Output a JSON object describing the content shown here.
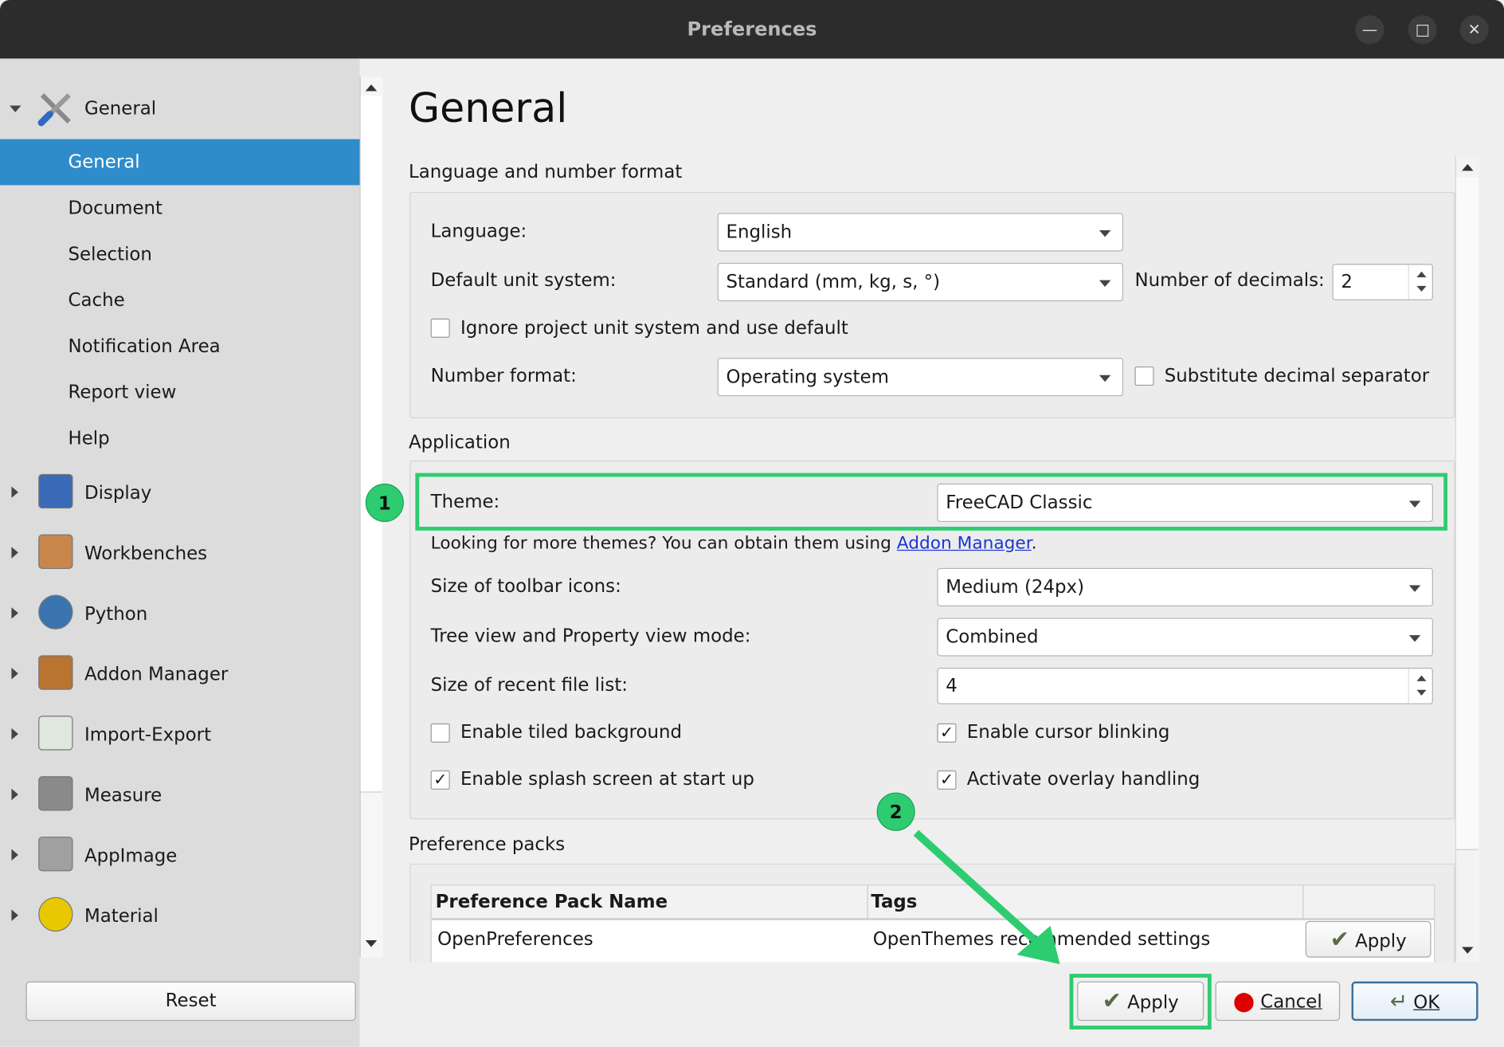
{
  "window": {
    "title": "Preferences",
    "controls": [
      "minimize",
      "maximize",
      "close"
    ]
  },
  "sidebar": {
    "group_general": {
      "label": "General",
      "expanded": true,
      "children": [
        "General",
        "Document",
        "Selection",
        "Cache",
        "Notification Area",
        "Report view",
        "Help"
      ],
      "selected": "General"
    },
    "groups": [
      {
        "label": "Display",
        "icon": "monitor-icon"
      },
      {
        "label": "Workbenches",
        "icon": "workbench-box-icon"
      },
      {
        "label": "Python",
        "icon": "python-icon"
      },
      {
        "label": "Addon Manager",
        "icon": "addon-box-icon"
      },
      {
        "label": "Import-Export",
        "icon": "import-export-icon"
      },
      {
        "label": "Measure",
        "icon": "caliper-icon"
      },
      {
        "label": "AppImage",
        "icon": "appimage-icon"
      },
      {
        "label": "Material",
        "icon": "material-sphere-icon"
      }
    ],
    "reset_label": "Reset"
  },
  "page": {
    "heading": "General"
  },
  "lang_group": {
    "title": "Language and number format",
    "language_label": "Language:",
    "language_value": "English",
    "unit_label": "Default unit system:",
    "unit_value": "Standard (mm, kg, s, °)",
    "decimals_label": "Number of decimals:",
    "decimals_value": "2",
    "ignore_label": "Ignore project unit system and use default",
    "ignore_checked": false,
    "numformat_label": "Number format:",
    "numformat_value": "Operating system",
    "substitute_label": "Substitute decimal separator",
    "substitute_checked": false
  },
  "app_group": {
    "title": "Application",
    "theme_label": "Theme:",
    "theme_value": "FreeCAD Classic",
    "themes_hint": "Looking for more themes? You can obtain them using ",
    "themes_link": "Addon Manager",
    "themes_hint_end": ".",
    "toolbar_label": "Size of toolbar icons:",
    "toolbar_value": "Medium (24px)",
    "treeview_label": "Tree view and Property view mode:",
    "treeview_value": "Combined",
    "recent_label": "Size of recent file list:",
    "recent_value": "4",
    "tiled_label": "Enable tiled background",
    "tiled_checked": false,
    "blink_label": "Enable cursor blinking",
    "blink_checked": true,
    "splash_label": "Enable splash screen at start up",
    "splash_checked": true,
    "overlay_label": "Activate overlay handling",
    "overlay_checked": true
  },
  "packs_group": {
    "title": "Preference packs",
    "columns": [
      "Preference Pack Name",
      "Tags",
      ""
    ],
    "rows": [
      {
        "name": "OpenPreferences",
        "tags": "OpenThemes recommended settings",
        "action": "Apply"
      }
    ]
  },
  "footer": {
    "apply": "Apply",
    "cancel": "Cancel",
    "ok": "OK"
  },
  "annotations": {
    "badge1": "1",
    "badge2": "2",
    "highlight_color": "#2ecc71"
  },
  "colors": {
    "selection": "#2e8ccb",
    "titlebar": "#2c2c2c"
  }
}
